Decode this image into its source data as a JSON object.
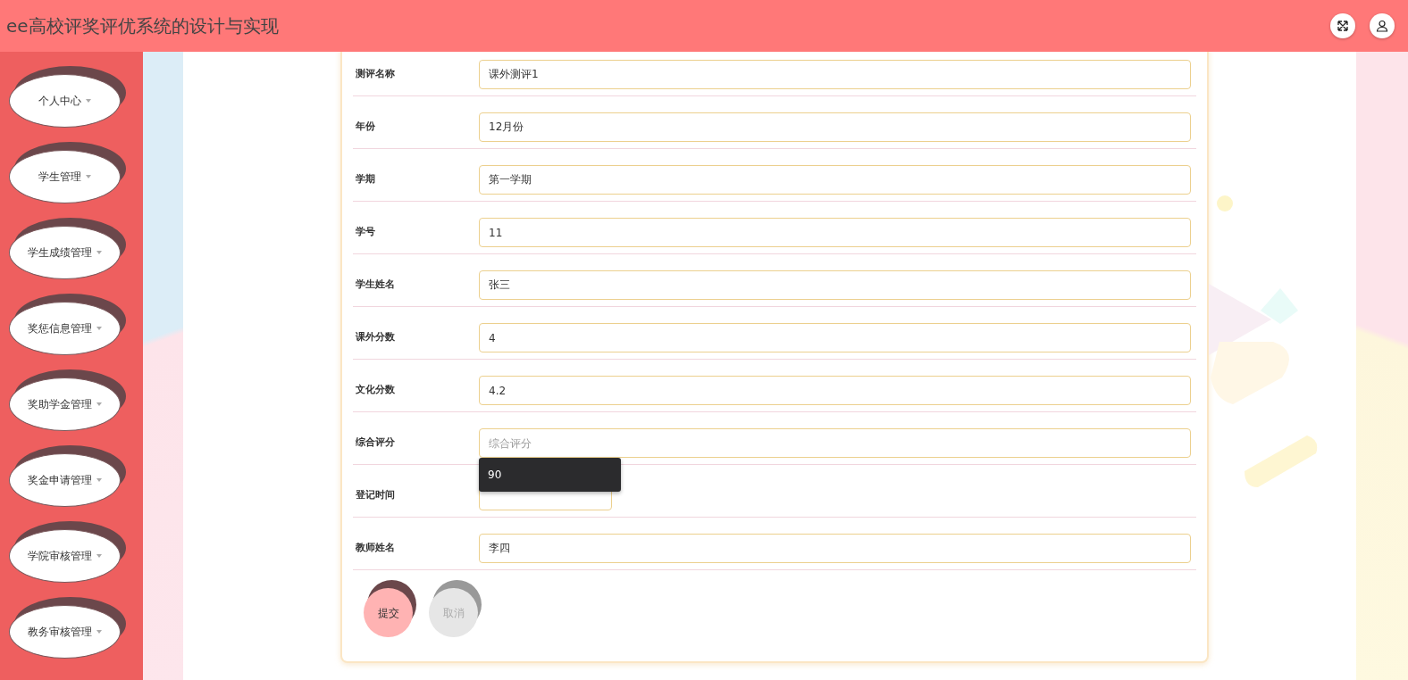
{
  "header": {
    "title": "ee高校评奖评优系统的设计与实现"
  },
  "sidebar": {
    "items": [
      {
        "label": "个人中心"
      },
      {
        "label": "学生管理"
      },
      {
        "label": "学生成绩管理"
      },
      {
        "label": "奖惩信息管理"
      },
      {
        "label": "奖助学金管理"
      },
      {
        "label": "奖金申请管理"
      },
      {
        "label": "学院审核管理"
      },
      {
        "label": "教务审核管理"
      }
    ]
  },
  "form": {
    "fields": [
      {
        "kind": "text",
        "label": "测评名称",
        "value": "课外测评1"
      },
      {
        "kind": "text",
        "label": "年份",
        "value": "12月份"
      },
      {
        "kind": "text",
        "label": "学期",
        "value": "第一学期"
      },
      {
        "kind": "text",
        "label": "学号",
        "value": "11"
      },
      {
        "kind": "text",
        "label": "学生姓名",
        "value": "张三"
      },
      {
        "kind": "text",
        "label": "课外分数",
        "value": "4"
      },
      {
        "kind": "text",
        "label": "文化分数",
        "value": "4.2"
      },
      {
        "kind": "text",
        "label": "综合评分",
        "placeholder": "综合评分",
        "suggestions": [
          "90"
        ]
      },
      {
        "kind": "date",
        "label": "登记时间"
      },
      {
        "kind": "text",
        "label": "教师姓名",
        "value": "李四"
      }
    ],
    "buttons": [
      {
        "kind": "primary",
        "label": "提交"
      },
      {
        "kind": "secondary",
        "label": "取消"
      }
    ]
  }
}
